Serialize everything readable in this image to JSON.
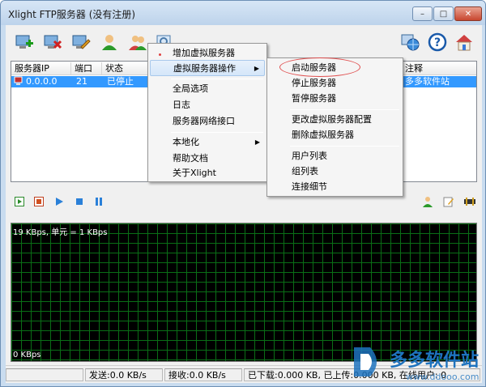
{
  "window": {
    "title": "Xlight FTP服务器 (没有注册)"
  },
  "caption_buttons": {
    "minimize": "–",
    "maximize": "□",
    "close": "✕"
  },
  "toolbar_icons": [
    "add-server-icon",
    "delete-server-icon",
    "edit-server-icon",
    "user-icon",
    "users-icon",
    "view-icon",
    "network-icon",
    "help-icon",
    "home-icon"
  ],
  "table": {
    "columns": [
      "服务器IP",
      "端口",
      "状态",
      "注释"
    ],
    "rows": [
      {
        "ip": "0.0.0.0",
        "port": "21",
        "status": "已停止",
        "comment": "多多软件站"
      }
    ]
  },
  "menu_main": {
    "items": [
      "增加虚拟服务器",
      "虚拟服务器操作",
      "全局选项",
      "日志",
      "服务器网络接口",
      "本地化",
      "帮助文档",
      "关于Xlight"
    ]
  },
  "menu_sub": {
    "items": [
      "启动服务器",
      "停止服务器",
      "暂停服务器",
      "更改虚拟服务器配置",
      "删除虚拟服务器",
      "用户列表",
      "组列表",
      "连接细节"
    ]
  },
  "graph": {
    "top_label": "19 KBps, 单元 = 1 KBps",
    "bottom_label": "0 KBps"
  },
  "status": {
    "send": "发送:0.0 KB/s",
    "recv": "接收:0.0 KB/s",
    "info": "已下载:0.000 KB, 已上传:0.000 KB, 在线用户: 0"
  },
  "watermark": {
    "text": "多多软件站",
    "sub": "www.ddooo.com"
  },
  "colors": {
    "selection": "#3399ff",
    "graph_bg": "#000000",
    "grid": "#0a6e16",
    "accent": "#1e73be"
  }
}
